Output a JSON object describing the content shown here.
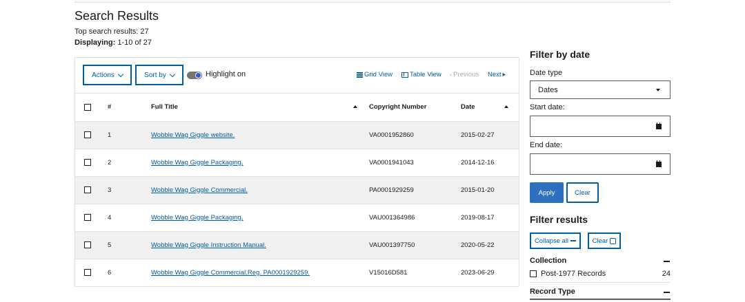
{
  "page": {
    "title": "Search Results",
    "top_results_text": "Top search results: 27",
    "displaying_label": "Displaying:",
    "displaying_value": " 1-10 of 27"
  },
  "toolbar": {
    "actions_label": "Actions",
    "sort_label": "Sort by",
    "highlight_label": "Highlight on",
    "grid_view": "Grid View",
    "table_view": "Table View",
    "previous": "Previous",
    "next": "Next"
  },
  "table": {
    "headers": [
      "#",
      "Full Title",
      "Copyright Number",
      "Date"
    ],
    "rows": [
      {
        "num": "1",
        "title": "Wobble Wag Giggle website.",
        "copyright": "VA0001952860",
        "date": "2015-02-27"
      },
      {
        "num": "2",
        "title": "Wobble Wag Giggle Packaging.",
        "copyright": "VA0001941043",
        "date": "2014-12-16"
      },
      {
        "num": "3",
        "title": "Wobble Wag Giggle Commercial.",
        "copyright": "PA0001929259",
        "date": "2015-01-20"
      },
      {
        "num": "4",
        "title": "Wobble Wag Giggle Packaging.",
        "copyright": "VAU001364986",
        "date": "2019-08-17"
      },
      {
        "num": "5",
        "title": "Wobble Wag Giggle Instruction Manual.",
        "copyright": "VAU001397750",
        "date": "2020-05-22"
      },
      {
        "num": "6",
        "title": "Wobble Wag Giggle Commercial.Reg. PA0001929259.",
        "copyright": "V15016D581",
        "date": "2023-06-29"
      }
    ]
  },
  "filter_date": {
    "heading": "Filter by date",
    "date_type_label": "Date type",
    "date_type_value": "Dates",
    "start_label": "Start date:",
    "end_label": "End date:",
    "apply_label": "Apply",
    "clear_label": "Clear"
  },
  "filter_results": {
    "heading": "Filter results",
    "collapse_label": "Collapse all",
    "clear_label": "Clear",
    "collection_title": "Collection",
    "collection_item_label": "Post-1977 Records",
    "collection_item_count": "24",
    "record_type_title": "Record Type"
  },
  "colors": {
    "accent": "#005ea2",
    "apply_bg": "#2f6fc0",
    "stripe": "#f0f0f0"
  }
}
